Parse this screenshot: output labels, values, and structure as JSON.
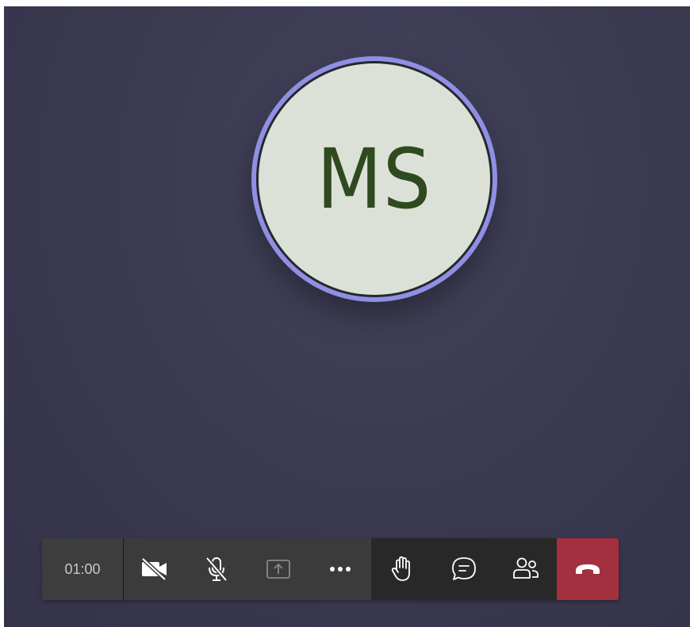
{
  "participant": {
    "initials": "MS"
  },
  "call_controls": {
    "timer": "01:00",
    "buttons": [
      {
        "id": "camera",
        "icon": "camera-off-icon"
      },
      {
        "id": "microphone",
        "icon": "mic-off-icon"
      },
      {
        "id": "share",
        "icon": "share-screen-icon"
      },
      {
        "id": "more",
        "icon": "more-options-icon"
      },
      {
        "id": "raise-hand",
        "icon": "raise-hand-icon"
      },
      {
        "id": "chat",
        "icon": "chat-icon"
      },
      {
        "id": "participants",
        "icon": "participants-icon"
      },
      {
        "id": "hang-up",
        "icon": "hang-up-icon"
      }
    ]
  },
  "colors": {
    "avatar_ring": "#8f8fe3",
    "avatar_fill": "#dce1d8",
    "initials": "#2f4a1e",
    "hangup": "#a4303f",
    "background": "#3b3a51"
  }
}
